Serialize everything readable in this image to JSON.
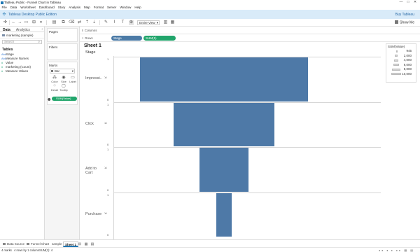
{
  "window": {
    "title": "Tableau Public - Funnel Chart in Tableau",
    "controls": [
      "—",
      "□",
      "✕"
    ]
  },
  "menu": [
    "File",
    "Data",
    "Worksheet",
    "Dashboard",
    "Story",
    "Analysis",
    "Map",
    "Format",
    "Server",
    "Window",
    "Help"
  ],
  "banner": {
    "edition": "Tableau Desktop Public Edition",
    "buy": "Buy Tableau"
  },
  "toolbar": {
    "view_select": "Entire View",
    "show_me": "Show Me"
  },
  "data_pane": {
    "tabs": [
      "Data",
      "Analytics"
    ],
    "data_source": "marketing (sample)",
    "search_placeholder": "Search",
    "tables_header": "Tables",
    "fields": [
      {
        "name": "Stage",
        "kind": "dimension",
        "icon": "Abc"
      },
      {
        "name": "Measure Names",
        "kind": "dimension",
        "icon": "Abc"
      },
      {
        "name": "Value",
        "kind": "measure",
        "icon": "#"
      },
      {
        "name": "marketing (Count)",
        "kind": "measure",
        "icon": "#"
      },
      {
        "name": "Measure Values",
        "kind": "measure",
        "icon": "#"
      }
    ]
  },
  "cards": {
    "pages": "Pages",
    "filters": "Filters",
    "marks": "Marks",
    "mark_type": "Bar",
    "mark_buttons": [
      "Color",
      "Size",
      "Label",
      "Detail",
      "Tooltip"
    ],
    "size_pill": "SUM(Value)"
  },
  "shelves": {
    "columns_label": "Columns",
    "rows_label": "Rows",
    "row_pills": [
      "Stage",
      "SUM(1)"
    ]
  },
  "sheet": {
    "title": "Sheet 1",
    "row_header": "Stage",
    "axis_top": "1",
    "axis_bottom": "0"
  },
  "chart_data": {
    "type": "bar",
    "categories": [
      "Impressi..",
      "Click",
      "Add to Cart",
      "Purchase"
    ],
    "values": [
      10000,
      6000,
      2900,
      945
    ],
    "bar_value": 1,
    "ylim": [
      0,
      1
    ],
    "color": "#4e79a7",
    "legend": {
      "title": "SUM(Value)",
      "items": [
        "945",
        "2,000",
        "4,000",
        "6,000",
        "8,000",
        "10,000"
      ]
    }
  },
  "sheet_tabs": [
    "Data Source",
    "Funnel Chart",
    "sample",
    "Sheet 1"
  ],
  "status": {
    "marks": "4 marks",
    "rows_cols": "4 rows by 1 column",
    "sum": "SUM(1): 4"
  }
}
